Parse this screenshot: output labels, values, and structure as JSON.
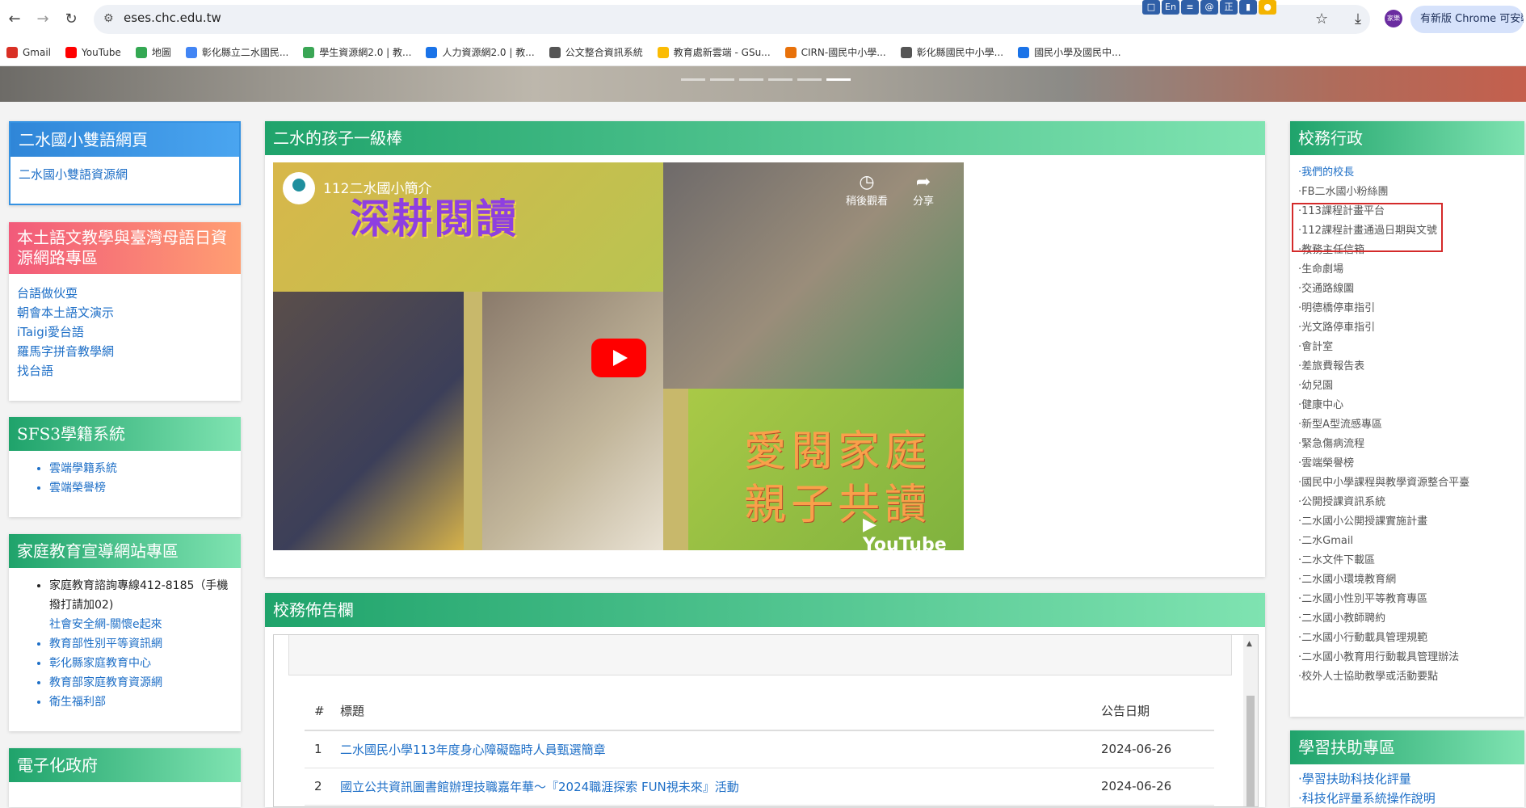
{
  "browser": {
    "url": "eses.chc.edu.tw",
    "ext_icons": [
      "□",
      "En",
      "≡",
      "@",
      "正",
      "▮",
      "●"
    ],
    "profile_label": "家樂",
    "update_label": "有新版 Chrome 可安裝"
  },
  "bookmarks": [
    {
      "label": "Gmail",
      "color": "#d93025"
    },
    {
      "label": "YouTube",
      "color": "#ff0000"
    },
    {
      "label": "地圖",
      "color": "#34a853"
    },
    {
      "label": "彰化縣立二水國民...",
      "color": "#4285f4"
    },
    {
      "label": "學生資源網2.0 | 教...",
      "color": "#3aa655"
    },
    {
      "label": "人力資源網2.0 | 教...",
      "color": "#1a73e8"
    },
    {
      "label": "公文整合資訊系統",
      "color": "#555555"
    },
    {
      "label": "教育處新雲端 - GSu...",
      "color": "#fbbc05"
    },
    {
      "label": "CIRN-國民中小學...",
      "color": "#e8710a"
    },
    {
      "label": "彰化縣國民中小學...",
      "color": "#555555"
    },
    {
      "label": "國民小學及國民中...",
      "color": "#1a73e8"
    }
  ],
  "left": {
    "bilingual": {
      "title": "二水國小雙語網頁",
      "links": [
        "二水國小雙語資源網"
      ]
    },
    "native": {
      "title": "本土語文教學與臺灣母語日資源網路專區",
      "links": [
        "台語做伙耍",
        "朝會本土語文演示",
        "iTaigi愛台語",
        "羅馬字拼音教學網",
        "找台語"
      ]
    },
    "sfs3": {
      "title": "SFS3學籍系統",
      "links": [
        "雲端學籍系統",
        "雲端榮譽榜"
      ]
    },
    "family": {
      "title": "家庭教育宣導網站專區",
      "hotline": "家庭教育諮詢專線412-8185（手機撥打請加02)",
      "sublink": "社會安全網-關懷e起來",
      "links": [
        "教育部性別平等資訊網",
        "彰化縣家庭教育中心",
        "教育部家庭教育資源網",
        "衛生福利部"
      ]
    },
    "egov": {
      "title": "電子化政府"
    }
  },
  "center": {
    "video_panel_title": "二水的孩子一級棒",
    "video": {
      "title": "112二水國小簡介",
      "overlay_big": "深耕閱讀",
      "overlay_line1": "愛閱家庭",
      "overlay_line2": "親子共讀",
      "watch_later": "稍後觀看",
      "share": "分享",
      "yt_logo": "▶ YouTube"
    },
    "news_panel_title": "校務佈告欄",
    "table": {
      "headers": [
        "#",
        "標題",
        "公告日期"
      ],
      "rows": [
        {
          "n": "1",
          "title": "二水國民小學113年度身心障礙臨時人員甄選簡章",
          "date": "2024-06-26"
        },
        {
          "n": "2",
          "title": "國立公共資訊圖書館辦理技職嘉年華～『2024職涯探索 FUN視未來』活動",
          "date": "2024-06-26"
        }
      ]
    }
  },
  "right": {
    "admin": {
      "title": "校務行政",
      "links": [
        {
          "label": "·我們的校長",
          "blue": true
        },
        {
          "label": "·FB二水國小粉絲團",
          "blue": false
        },
        {
          "label": "·113課程計畫平台",
          "blue": false
        },
        {
          "label": "·112課程計畫通過日期與文號",
          "blue": false
        },
        {
          "label": "·教務主任信箱",
          "blue": false
        },
        {
          "label": "·生命劇場",
          "blue": false
        },
        {
          "label": "·交通路線圖",
          "blue": false
        },
        {
          "label": "·明德橋停車指引",
          "blue": false
        },
        {
          "label": "·光文路停車指引",
          "blue": false
        },
        {
          "label": "·會計室",
          "blue": false
        },
        {
          "label": "·差旅費報告表",
          "blue": false
        },
        {
          "label": "·幼兒園",
          "blue": false
        },
        {
          "label": "·健康中心",
          "blue": false
        },
        {
          "label": "·新型A型流感專區",
          "blue": false
        },
        {
          "label": "·緊急傷病流程",
          "blue": false
        },
        {
          "label": "·雲端榮譽榜",
          "blue": false
        },
        {
          "label": "·國民中小學課程與教學資源整合平臺",
          "blue": false
        },
        {
          "label": "·公開授課資訊系統",
          "blue": false
        },
        {
          "label": "·二水國小公開授課實施計畫",
          "blue": false
        },
        {
          "label": "·二水Gmail",
          "blue": false
        },
        {
          "label": "·二水文件下載區",
          "blue": false
        },
        {
          "label": "·二水國小環境教育網",
          "blue": false
        },
        {
          "label": "·二水國小性別平等教育專區",
          "blue": false
        },
        {
          "label": "·二水國小教師聘約",
          "blue": false
        },
        {
          "label": "·二水國小行動載具管理規範",
          "blue": false
        },
        {
          "label": "·二水國小教育用行動載具管理辦法",
          "blue": false
        },
        {
          "label": "·校外人士協助教學或活動要點",
          "blue": false
        }
      ]
    },
    "assist": {
      "title": "學習扶助專區",
      "links": [
        "·學習扶助科技化評量",
        "·科技化評量系統操作說明"
      ]
    }
  }
}
